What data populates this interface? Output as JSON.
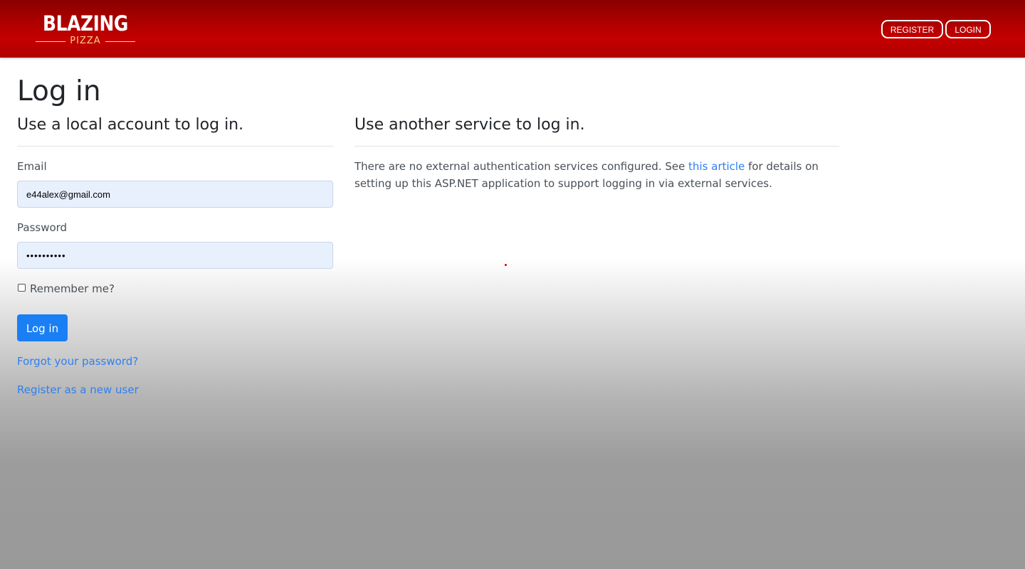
{
  "header": {
    "logo_main": "BLAZING",
    "logo_sub": "PIZZA",
    "register_label": "REGISTER",
    "login_label": "LOGIN"
  },
  "page": {
    "title": "Log in"
  },
  "local_login": {
    "heading": "Use a local account to log in.",
    "email_label": "Email",
    "email_value": "e44alex@gmail.com",
    "password_label": "Password",
    "password_value": "••••••••••",
    "remember_label": "Remember me?",
    "remember_checked": false,
    "submit_label": "Log in",
    "forgot_link": "Forgot your password?",
    "register_link": "Register as a new user"
  },
  "external_login": {
    "heading": "Use another service to log in.",
    "text_before": "There are no external authentication services configured. See ",
    "link_text": "this article",
    "text_after": " for details on setting up this ASP.NET application to support logging in via external services."
  },
  "colors": {
    "header_red": "#c40000",
    "primary_button": "#1a7ff4",
    "link": "#2f7ff0",
    "input_autofill_bg": "#e8f0fe"
  }
}
